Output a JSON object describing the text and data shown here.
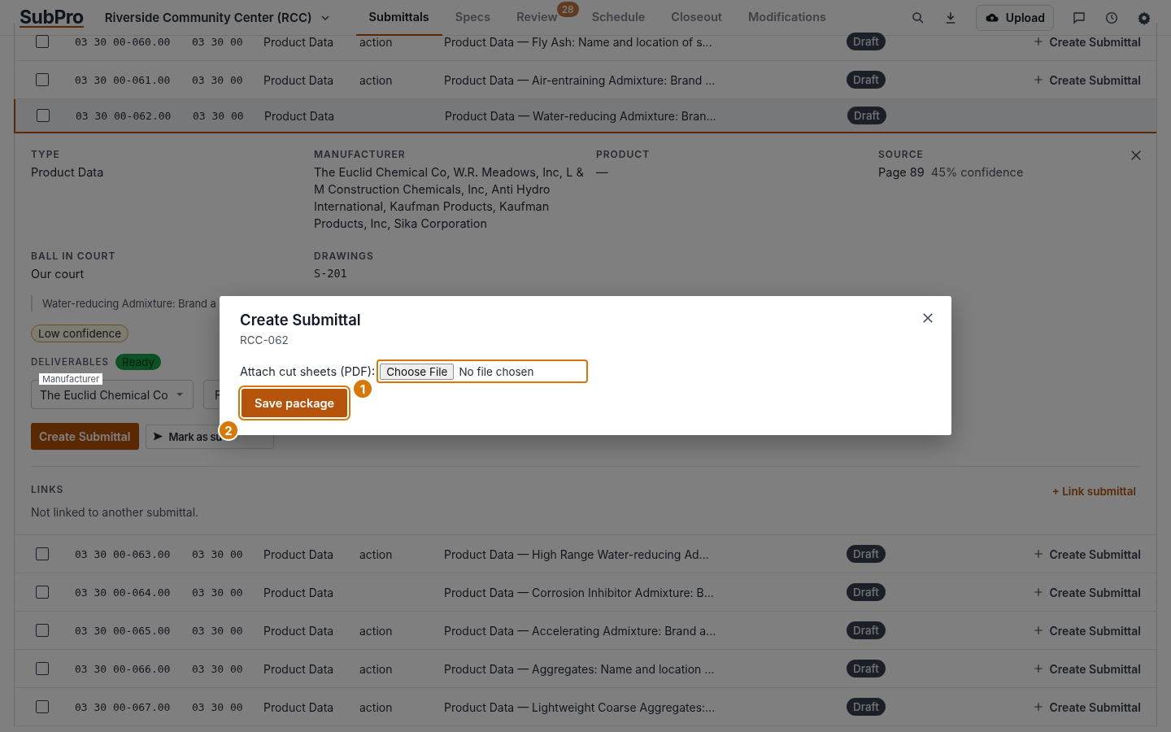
{
  "nav": {
    "logo": "SubPro",
    "project": "Riverside Community Center (RCC)",
    "tabs": [
      {
        "label": "Submittals",
        "selected": true
      },
      {
        "label": "Specs",
        "selected": false
      },
      {
        "label": "Review",
        "selected": false,
        "badge": "28"
      },
      {
        "label": "Schedule",
        "selected": false
      },
      {
        "label": "Closeout",
        "selected": false
      },
      {
        "label": "Modifications",
        "selected": false
      }
    ],
    "upload": "Upload"
  },
  "rows": [
    {
      "checked": false,
      "code": "03 30 00-060.00",
      "section": "03 30 00",
      "type": "Product Data",
      "action": "action",
      "title": "Product Data — Fly Ash: Name and location of s...",
      "status": "Draft",
      "create": "Create Submittal",
      "expanded": false
    },
    {
      "checked": false,
      "code": "03 30 00-061.00",
      "section": "03 30 00",
      "type": "Product Data",
      "action": "action",
      "title": "Product Data — Air-entraining Admixture: Brand ...",
      "status": "Draft",
      "create": "Create Submittal",
      "expanded": false
    },
    {
      "checked": false,
      "code": "03 30 00-062.00",
      "section": "03 30 00",
      "type": "Product Data",
      "title": "Product Data — Water-reducing Admixture: Bran...",
      "status": "Draft",
      "expanded": true
    },
    {
      "checked": false,
      "code": "03 30 00-063.00",
      "section": "03 30 00",
      "type": "Product Data",
      "action": "action",
      "title": "Product Data — High Range Water-reducing Ad...",
      "status": "Draft",
      "create": "Create Submittal",
      "expanded": false
    },
    {
      "checked": false,
      "code": "03 30 00-064.00",
      "section": "03 30 00",
      "type": "Product Data",
      "title": "Product Data — Corrosion Inhibitor Admixture: B...",
      "status": "Draft",
      "create": "Create Submittal",
      "expanded": false
    },
    {
      "checked": false,
      "code": "03 30 00-065.00",
      "section": "03 30 00",
      "type": "Product Data",
      "action": "action",
      "title": "Product Data — Accelerating Admixture: Brand a...",
      "status": "Draft",
      "create": "Create Submittal",
      "expanded": false
    },
    {
      "checked": false,
      "code": "03 30 00-066.00",
      "section": "03 30 00",
      "type": "Product Data",
      "action": "action",
      "title": "Product Data — Aggregates: Name and location ...",
      "status": "Draft",
      "create": "Create Submittal",
      "expanded": false
    },
    {
      "checked": false,
      "code": "03 30 00-067.00",
      "section": "03 30 00",
      "type": "Product Data",
      "action": "action",
      "title": "Product Data — Lightweight Coarse Aggregates:...",
      "status": "Draft",
      "create": "Create Submittal",
      "expanded": false
    }
  ],
  "detail": {
    "fields": [
      {
        "label": "TYPE",
        "value": "Product Data"
      },
      {
        "label": "MANUFACTURER",
        "value": "The Euclid Chemical Co, W.R. Meadows, Inc, L & M Construction Chemicals, Inc, Anti Hydro International, Kaufman Products, Kaufman Products, Inc, Sika Corporation"
      },
      {
        "label": "PRODUCT",
        "value": "—"
      },
      {
        "label": "SOURCE",
        "value": "Page 89",
        "note": "45% confidence"
      },
      {
        "label": "BALL IN COURT",
        "value": "Our court"
      },
      {
        "label": "DRAWINGS",
        "value": "S-201",
        "kind": "mono"
      }
    ],
    "quote": "Water-reducing Admixture: Brand a",
    "confidence": "Low confidence",
    "deliverables": {
      "label": "DELIVERABLES",
      "status": "Ready"
    },
    "selects": [
      {
        "label": "Manufacturer",
        "value": "The Euclid Chemical Co"
      },
      {
        "value": "F"
      }
    ],
    "create": "Create Submittal",
    "mark": "Mark as su",
    "links": {
      "label": "LINKS",
      "add": "+ Link submittal",
      "empty": "Not linked to another submittal."
    }
  },
  "modal": {
    "title": "Create Submittal",
    "subtitle": "RCC-062",
    "attach_label": "Attach cut sheets (PDF):",
    "choose": "Choose File",
    "file": "No file chosen",
    "save": "Save package",
    "markers": [
      "1",
      "2"
    ]
  }
}
